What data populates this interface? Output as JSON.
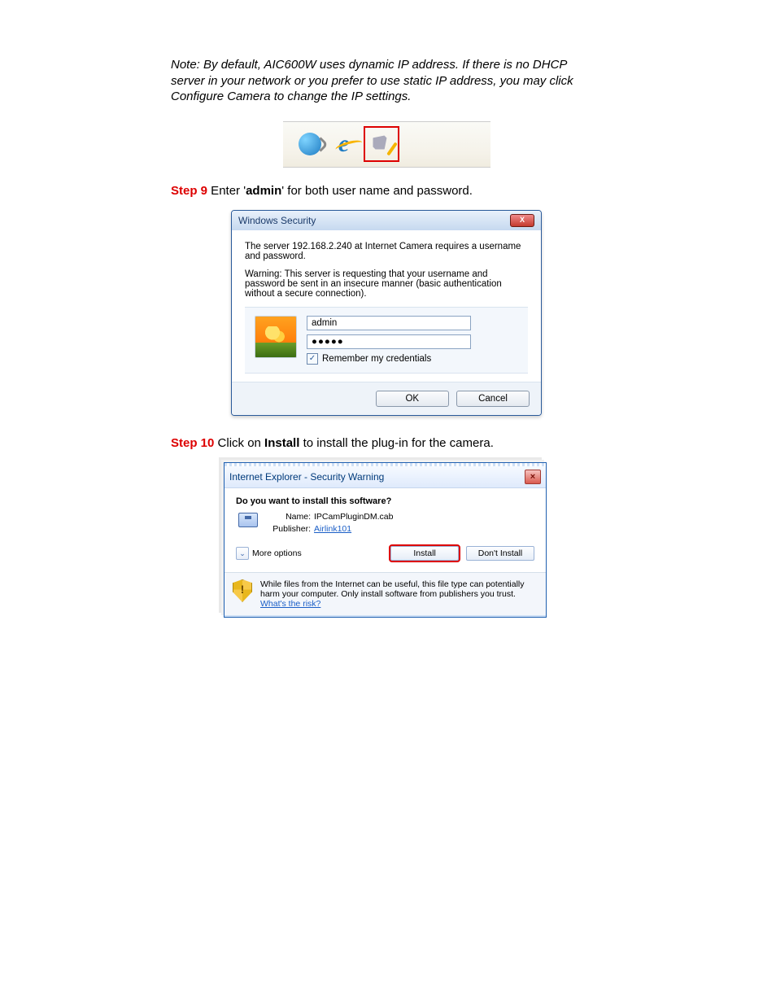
{
  "note": "Note: By default, AIC600W uses dynamic IP address. If there is no DHCP server in your network or you prefer to use static IP address, you may click Configure Camera to change the IP settings.",
  "step9": {
    "label": "Step 9",
    "text_before": " Enter '",
    "bold": "admin",
    "text_after": "' for both user name and password."
  },
  "win_security": {
    "title": "Windows Security",
    "msg1": "The server 192.168.2.240 at Internet Camera requires a username and password.",
    "msg2": "Warning: This server is requesting that your username and password be sent in an insecure manner (basic authentication without a secure connection).",
    "user_value": "admin",
    "pw_value": "●●●●●",
    "remember": "Remember my credentials",
    "ok": "OK",
    "cancel": "Cancel"
  },
  "step10": {
    "label": "Step 10",
    "text_before": " Click on ",
    "bold": "Install",
    "text_after": " to install the plug-in for the camera."
  },
  "ie_warn": {
    "title": "Internet Explorer - Security Warning",
    "q": "Do you want to install this software?",
    "name_lbl": "Name:",
    "name_val": "IPCamPluginDM.cab",
    "pub_lbl": "Publisher:",
    "pub_val": "Airlink101",
    "more": "More options",
    "install": "Install",
    "dont": "Don't Install",
    "footer_text": "While files from the Internet can be useful, this file type can potentially harm your computer. Only install software from publishers you trust. ",
    "risk": "What's the risk?"
  }
}
